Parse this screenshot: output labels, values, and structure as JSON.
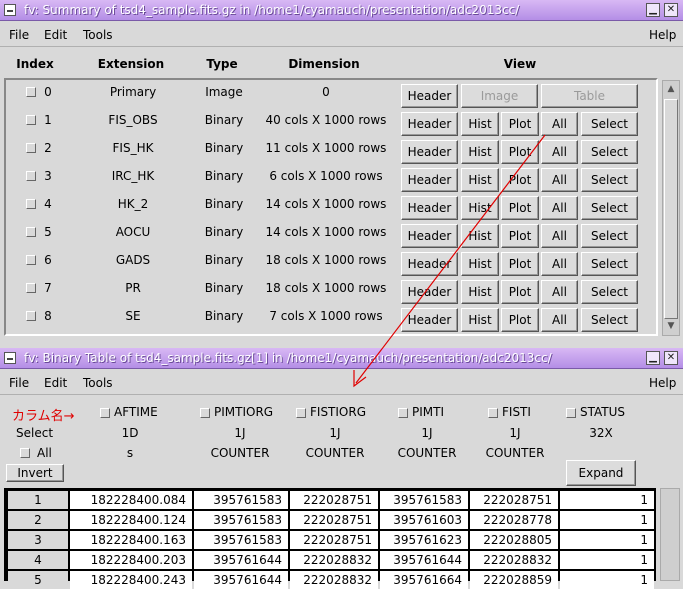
{
  "window1": {
    "title": "fv: Summary of tsd4_sample.fits.gz in /home1/cyamauch/presentation/adc2013cc/",
    "min_btn": "▁",
    "close_btn": "✕"
  },
  "menu1": {
    "file": "File",
    "edit": "Edit",
    "tools": "Tools",
    "help": "Help"
  },
  "summary": {
    "headers": {
      "index": "Index",
      "extension": "Extension",
      "type": "Type",
      "dimension": "Dimension",
      "view": "View"
    },
    "rows": [
      {
        "index": "0",
        "extension": "Primary",
        "type": "Image",
        "dimension": "0"
      },
      {
        "index": "1",
        "extension": "FIS_OBS",
        "type": "Binary",
        "dimension": "40 cols X 1000 rows"
      },
      {
        "index": "2",
        "extension": "FIS_HK",
        "type": "Binary",
        "dimension": "11 cols X 1000 rows"
      },
      {
        "index": "3",
        "extension": "IRC_HK",
        "type": "Binary",
        "dimension": "6 cols X 1000 rows"
      },
      {
        "index": "4",
        "extension": "HK_2",
        "type": "Binary",
        "dimension": "14 cols X 1000 rows"
      },
      {
        "index": "5",
        "extension": "AOCU",
        "type": "Binary",
        "dimension": "14 cols X 1000 rows"
      },
      {
        "index": "6",
        "extension": "GADS",
        "type": "Binary",
        "dimension": "18 cols X 1000 rows"
      },
      {
        "index": "7",
        "extension": "PR",
        "type": "Binary",
        "dimension": "18 cols X 1000 rows"
      },
      {
        "index": "8",
        "extension": "SE",
        "type": "Binary",
        "dimension": "7 cols X 1000 rows"
      }
    ],
    "buttons": {
      "header": "Header",
      "image": "Image",
      "table": "Table",
      "hist": "Hist",
      "plot": "Plot",
      "all": "All",
      "select": "Select"
    }
  },
  "window2": {
    "title": "fv: Binary Table of tsd4_sample.fits.gz[1] in /home1/cyamauch/presentation/adc2013cc/",
    "min_btn": "▁",
    "close_btn": "✕"
  },
  "menu2": {
    "file": "File",
    "edit": "Edit",
    "tools": "Tools",
    "help": "Help"
  },
  "annotation": {
    "text": "カラム名→",
    "color": "#e00000"
  },
  "table": {
    "select_label": "Select",
    "all_label": "All",
    "invert_label": "Invert",
    "expand_label": "Expand",
    "columns": [
      {
        "name": "AFTIME",
        "format": "1D",
        "unit": "s"
      },
      {
        "name": "PIMTIORG",
        "format": "1J",
        "unit": "COUNTER"
      },
      {
        "name": "FISTIORG",
        "format": "1J",
        "unit": "COUNTER"
      },
      {
        "name": "PIMTI",
        "format": "1J",
        "unit": "COUNTER"
      },
      {
        "name": "FISTI",
        "format": "1J",
        "unit": "COUNTER"
      },
      {
        "name": "STATUS",
        "format": "32X",
        "unit": ""
      }
    ],
    "rows": [
      [
        "1",
        "182228400.084",
        "395761583",
        "222028751",
        "395761583",
        "222028751",
        "1"
      ],
      [
        "2",
        "182228400.124",
        "395761583",
        "222028751",
        "395761603",
        "222028778",
        "1"
      ],
      [
        "3",
        "182228400.163",
        "395761583",
        "222028751",
        "395761623",
        "222028805",
        "1"
      ],
      [
        "4",
        "182228400.203",
        "395761644",
        "222028832",
        "395761644",
        "222028832",
        "1"
      ],
      [
        "5",
        "182228400.243",
        "395761644",
        "222028832",
        "395761664",
        "222028859",
        "1"
      ]
    ]
  },
  "colors": {
    "titlebar": "#b48ee6",
    "arrow": "#e00000"
  }
}
